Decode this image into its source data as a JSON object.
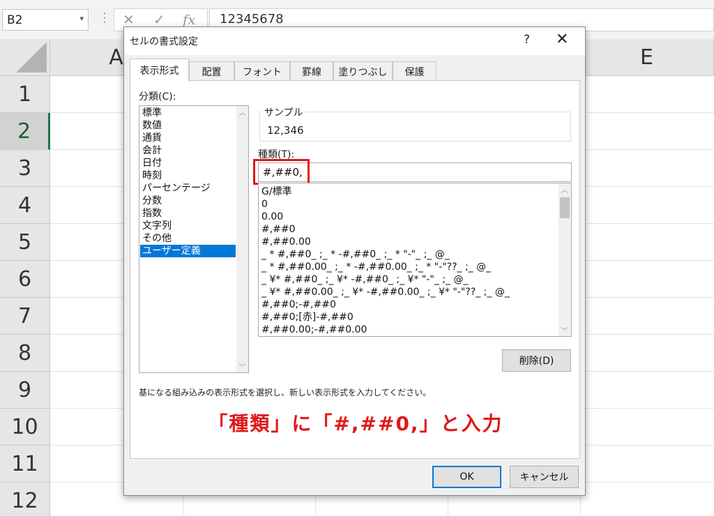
{
  "formula_bar": {
    "name_box": "B2",
    "name_box_arrow": "▾",
    "dots": "⋮",
    "cancel_icon": "✕",
    "enter_icon": "✓",
    "fx_label": "fx",
    "value": "12345678"
  },
  "grid": {
    "columns": [
      "A",
      "E"
    ],
    "rows": [
      "1",
      "2",
      "3",
      "4",
      "5",
      "6",
      "7",
      "8",
      "9",
      "10",
      "11",
      "12"
    ],
    "selected_row": "2"
  },
  "dialog": {
    "title": "セルの書式設定",
    "help": "?",
    "close": "✕",
    "tabs": [
      "表示形式",
      "配置",
      "フォント",
      "罫線",
      "塗りつぶし",
      "保護"
    ],
    "active_tab": "表示形式",
    "category_label": "分類(C):",
    "categories": [
      "標準",
      "数値",
      "通貨",
      "会計",
      "日付",
      "時刻",
      "パーセンテージ",
      "分数",
      "指数",
      "文字列",
      "その他",
      "ユーザー定義"
    ],
    "selected_category": "ユーザー定義",
    "scroll_up": "︿",
    "scroll_down": "﹀",
    "sample_label": "サンプル",
    "sample_value": "12,346",
    "type_label": "種類(T):",
    "type_value": "#,##0,",
    "formats": [
      "G/標準",
      "0",
      "0.00",
      "#,##0",
      "#,##0.00",
      "_ * #,##0_ ;_ * -#,##0_ ;_ * \"-\"_ ;_ @_",
      "_ * #,##0.00_ ;_ * -#,##0.00_ ;_ * \"-\"??_ ;_ @_",
      "_ ¥* #,##0_ ;_ ¥* -#,##0_ ;_ ¥* \"-\"_ ;_ @_",
      "_ ¥* #,##0.00_ ;_ ¥* -#,##0.00_ ;_ ¥* \"-\"??_ ;_ @_",
      "#,##0;-#,##0",
      "#,##0;[赤]-#,##0",
      "#,##0.00;-#,##0.00"
    ],
    "delete_button": "削除(D)",
    "hint": "基になる組み込みの表示形式を選択し、新しい表示形式を入力してください。",
    "annotation": "「種類」に「#,##0,」と入力",
    "ok_button": "OK",
    "cancel_button": "キャンセル"
  },
  "colors": {
    "accent": "#0078d7",
    "annotation_red": "#e01818",
    "excel_green": "#217346"
  }
}
